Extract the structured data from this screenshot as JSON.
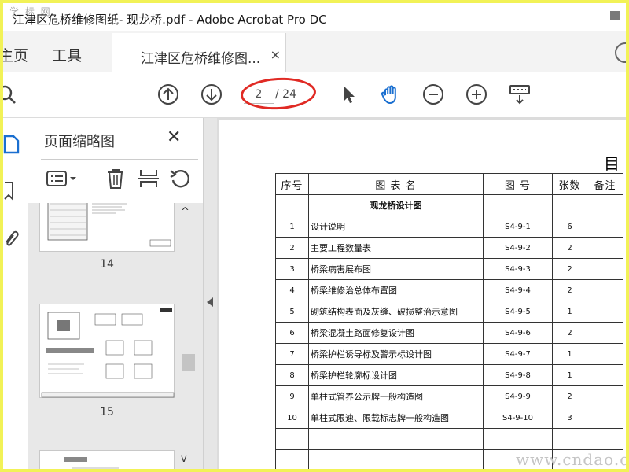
{
  "window": {
    "title": "江津区危桥维修图纸- 现龙桥.pdf - Adobe Acrobat Pro DC",
    "watermark": "学 标 网"
  },
  "tabs": {
    "home": "主页",
    "tools": "工具",
    "document": "江津区危桥维修图...",
    "document_close": "×"
  },
  "toolbar": {
    "current_page": "2",
    "total_pages": "/ 24",
    "icons": [
      "search-icon",
      "prev-page-icon",
      "next-page-icon",
      "select-arrow-icon",
      "hand-icon",
      "zoom-out-icon",
      "zoom-in-icon",
      "keyboard-icon"
    ],
    "annotation_color": "#e02a24"
  },
  "panel": {
    "title": "页面缩略图",
    "close": "✕",
    "thumbnails": [
      {
        "page": "14"
      },
      {
        "page": "15"
      }
    ],
    "scroll_up": "^",
    "scroll_down": "v"
  },
  "document": {
    "heading": "目",
    "table": {
      "headers": [
        "序号",
        "图 表 名",
        "图  号",
        "张数",
        "备注"
      ],
      "section": "现龙桥设计图",
      "rows": [
        {
          "no": "1",
          "name": "设计说明",
          "code": "S4-9-1",
          "count": "6",
          "note": ""
        },
        {
          "no": "2",
          "name": "主要工程数量表",
          "code": "S4-9-2",
          "count": "2",
          "note": ""
        },
        {
          "no": "3",
          "name": "桥梁病害展布图",
          "code": "S4-9-3",
          "count": "2",
          "note": ""
        },
        {
          "no": "4",
          "name": "桥梁维修治总体布置图",
          "code": "S4-9-4",
          "count": "2",
          "note": ""
        },
        {
          "no": "5",
          "name": "砌筑结构表面及灰缝、破损整治示意图",
          "code": "S4-9-5",
          "count": "1",
          "note": ""
        },
        {
          "no": "6",
          "name": "桥梁混凝土路面修复设计图",
          "code": "S4-9-6",
          "count": "2",
          "note": ""
        },
        {
          "no": "7",
          "name": "桥梁护栏诱导标及警示标设计图",
          "code": "S4-9-7",
          "count": "1",
          "note": ""
        },
        {
          "no": "8",
          "name": "桥梁护栏轮廓标设计图",
          "code": "S4-9-8",
          "count": "1",
          "note": ""
        },
        {
          "no": "9",
          "name": "单柱式管养公示牌一般构造图",
          "code": "S4-9-9",
          "count": "2",
          "note": ""
        },
        {
          "no": "10",
          "name": "单柱式限速、限载标志牌一般构造图",
          "code": "S4-9-10",
          "count": "3",
          "note": ""
        }
      ]
    },
    "watermark": "www.cndao.com"
  }
}
